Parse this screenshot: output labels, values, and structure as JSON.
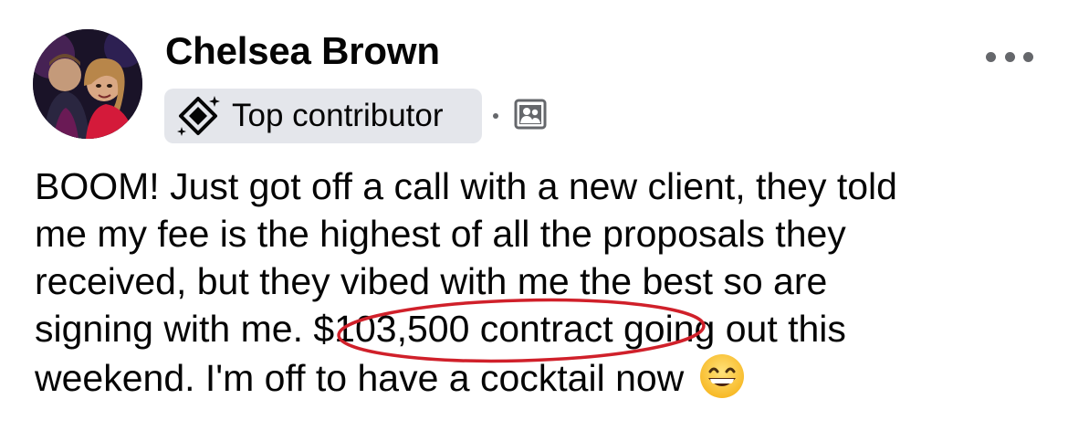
{
  "post": {
    "author": "Chelsea Brown",
    "badge_label": "Top contributor",
    "badge_icon": "diamond-sparkle-icon",
    "audience_icon": "members-group-icon",
    "more_icon": "more-options-icon",
    "text_line_1": "BOOM! Just got off a call with a new client, they told",
    "text_line_2": "me my fee is the highest of all the proposals they",
    "text_line_3": "received, but they vibed with me the best so are",
    "text_line_4a": "signing with me. ",
    "text_highlight": "$103,500 contract",
    "text_line_4b": " going out this",
    "text_line_5": "weekend. I'm off to have a cocktail now",
    "emoji": "grinning-face-with-smiling-eyes",
    "highlight_color": "#d0202a"
  },
  "colors": {
    "text": "#050505",
    "secondary": "#65676b",
    "badge_bg": "#e4e6eb",
    "highlight_ellipse": "#d0202a"
  }
}
